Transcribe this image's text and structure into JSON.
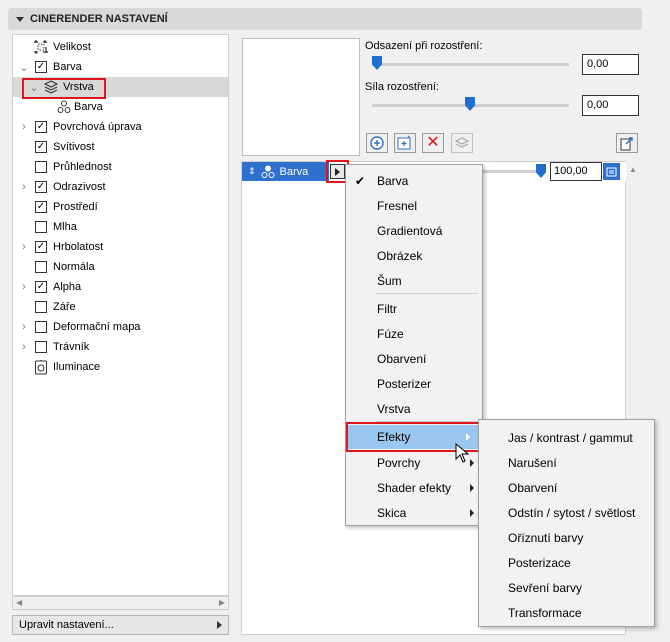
{
  "panel": {
    "title": "CINERENDER NASTAVENÍ"
  },
  "tree": {
    "items": [
      {
        "label": "Velikost",
        "checkbox": "none",
        "expandable": false
      },
      {
        "label": "Barva",
        "checkbox": "checked",
        "expandable": true,
        "expanded": true
      },
      {
        "label": "Vrstva",
        "checkbox": "none",
        "expandable": true,
        "expanded": true,
        "selected": true
      },
      {
        "label": "Barva",
        "checkbox": "none",
        "expandable": false
      },
      {
        "label": "Povrchová úprava",
        "checkbox": "checked",
        "expandable": true
      },
      {
        "label": "Svítivost",
        "checkbox": "checked",
        "expandable": false
      },
      {
        "label": "Průhlednost",
        "checkbox": "unchecked",
        "expandable": false
      },
      {
        "label": "Odrazivost",
        "checkbox": "checked",
        "expandable": true
      },
      {
        "label": "Prostředí",
        "checkbox": "checked",
        "expandable": false
      },
      {
        "label": "Mlha",
        "checkbox": "unchecked",
        "expandable": false
      },
      {
        "label": "Hrbolatost",
        "checkbox": "checked",
        "expandable": true
      },
      {
        "label": "Normála",
        "checkbox": "unchecked",
        "expandable": false
      },
      {
        "label": "Alpha",
        "checkbox": "checked",
        "expandable": true
      },
      {
        "label": "Záře",
        "checkbox": "unchecked",
        "expandable": false
      },
      {
        "label": "Deformační mapa",
        "checkbox": "unchecked",
        "expandable": true
      },
      {
        "label": "Trávník",
        "checkbox": "unchecked",
        "expandable": true
      },
      {
        "label": "Iluminace",
        "checkbox": "none",
        "expandable": false
      }
    ]
  },
  "settings_button": {
    "label": "Upravit nastavení..."
  },
  "sliders": [
    {
      "label": "Odsazení při rozostření:",
      "value": "0,00",
      "fraction": 0.0
    },
    {
      "label": "Síla rozostření:",
      "value": "0,00",
      "fraction": 0.5
    }
  ],
  "layer": {
    "name": "Barva",
    "value": "100,00",
    "fraction": 1.0
  },
  "context_menu": {
    "items": [
      {
        "label": "Barva",
        "checked": true
      },
      {
        "label": "Fresnel"
      },
      {
        "label": "Gradientová"
      },
      {
        "label": "Obrázek"
      },
      {
        "label": "Šum"
      },
      {
        "label": "Filtr"
      },
      {
        "label": "Fúze"
      },
      {
        "label": "Obarvení"
      },
      {
        "label": "Posterizer"
      },
      {
        "label": "Vrstva"
      },
      {
        "label": "Efekty",
        "submenu": true,
        "highlighted": true
      },
      {
        "label": "Povrchy",
        "submenu": true
      },
      {
        "label": "Shader efekty",
        "submenu": true
      },
      {
        "label": "Skica",
        "submenu": true
      }
    ]
  },
  "effects_submenu": {
    "items": [
      "Jas / kontrast / gammut",
      "Narušení",
      "Obarvení",
      "Odstín / sytost / světlost",
      "Oříznutí barvy",
      "Posterizace",
      "Sevření barvy",
      "Transformace"
    ]
  },
  "colors": {
    "accent": "#2f6fce",
    "highlight": "#99c7f0",
    "annotation": "#e0161d"
  }
}
